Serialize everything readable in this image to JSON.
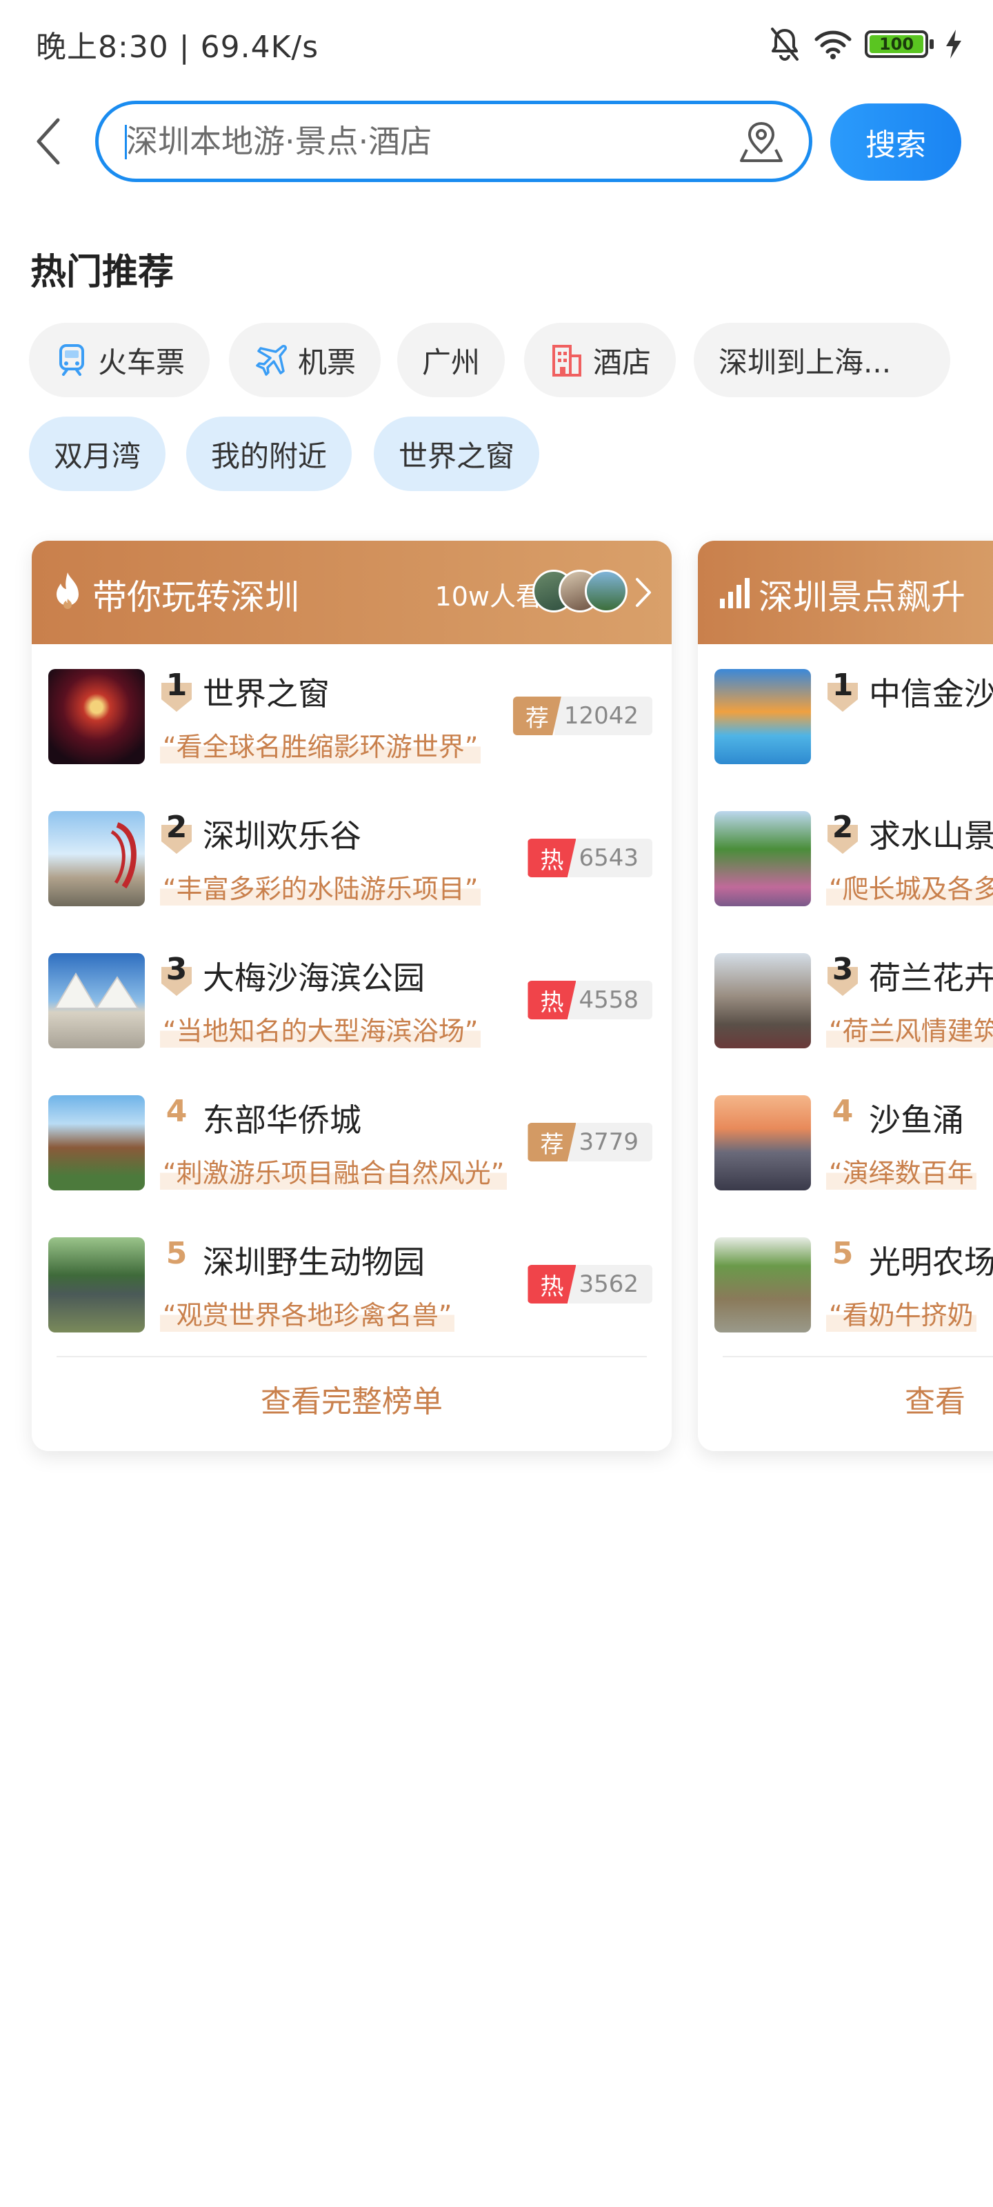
{
  "status_bar": {
    "time_speed": "晚上8:30 | 69.4K/s",
    "battery": "100"
  },
  "search": {
    "placeholder": "深圳本地游·景点·酒店",
    "button_label": "搜索"
  },
  "hot": {
    "title": "热门推荐",
    "chips_row1": [
      "火车票",
      "机票",
      "广州",
      "酒店",
      "深圳到上海..."
    ],
    "chips_row2": [
      "双月湾",
      "我的附近",
      "世界之窗"
    ]
  },
  "cards": [
    {
      "title": "带你玩转深圳",
      "viewers": "10w人看过",
      "view_all": "查看完整榜单",
      "items": [
        {
          "rank": "1",
          "name": "世界之窗",
          "quote": "“看全球名胜缩影环游世界”",
          "tag": "荐",
          "count": "12042"
        },
        {
          "rank": "2",
          "name": "深圳欢乐谷",
          "quote": "“丰富多彩的水陆游乐项目”",
          "tag": "热",
          "count": "6543"
        },
        {
          "rank": "3",
          "name": "大梅沙海滨公园",
          "quote": "“当地知名的大型海滨浴场”",
          "tag": "热",
          "count": "4558"
        },
        {
          "rank": "4",
          "name": "东部华侨城",
          "quote": "“刺激游乐项目融合自然风光”",
          "tag": "荐",
          "count": "3779"
        },
        {
          "rank": "5",
          "name": "深圳野生动物园",
          "quote": "“观赏世界各地珍禽名兽”",
          "tag": "热",
          "count": "3562"
        }
      ]
    },
    {
      "title": "深圳景点飙升",
      "view_all": "查看",
      "items": [
        {
          "rank": "1",
          "name": "中信金沙",
          "quote": ""
        },
        {
          "rank": "2",
          "name": "求水山景",
          "quote": "“爬长城及各多"
        },
        {
          "rank": "3",
          "name": "荷兰花卉",
          "quote": "“荷兰风情建筑"
        },
        {
          "rank": "4",
          "name": "沙鱼涌",
          "quote": "“演绎数百年"
        },
        {
          "rank": "5",
          "name": "光明农场",
          "quote": "“看奶牛挤奶"
        }
      ]
    }
  ],
  "colors": {
    "accent_blue": "#1a8cf0",
    "card_header": "#c9804c",
    "hot_red": "#f0444a",
    "rec_tan": "#d39a64"
  }
}
